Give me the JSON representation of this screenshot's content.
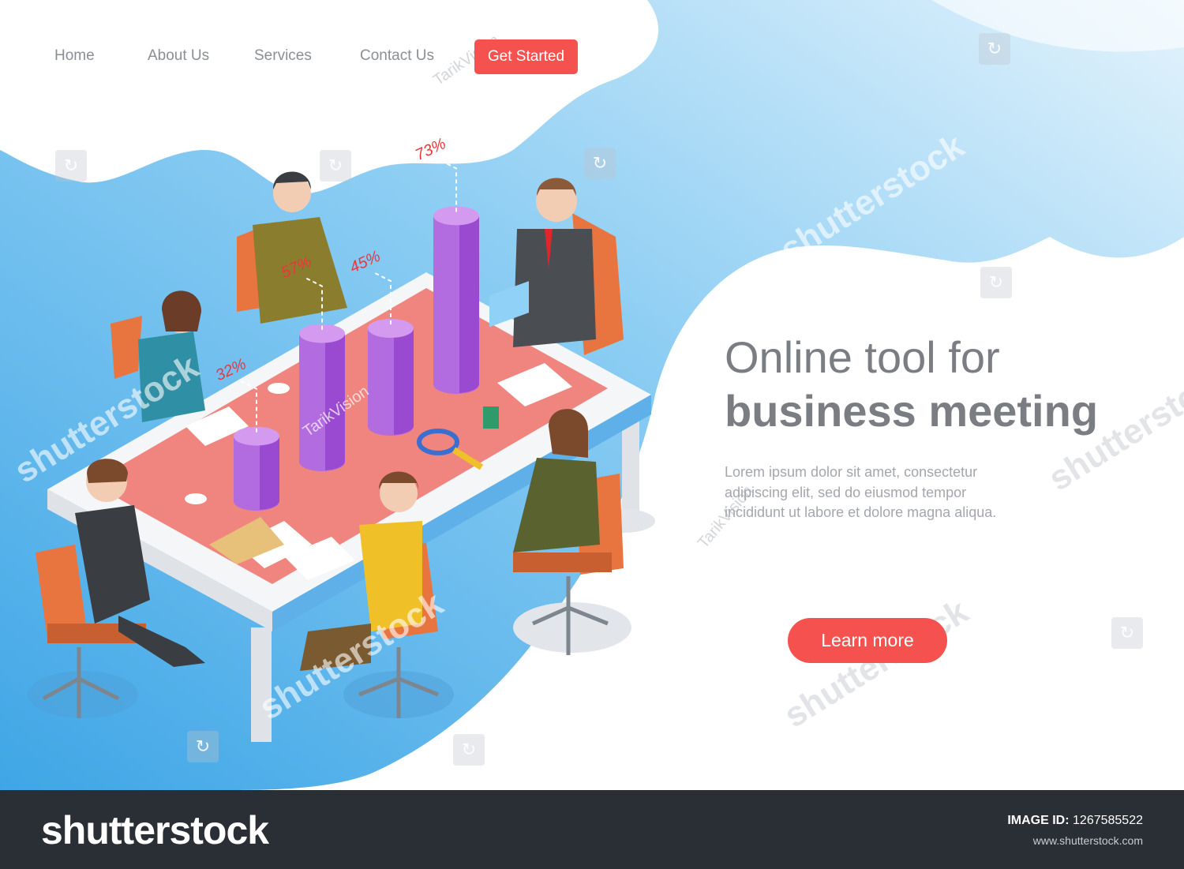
{
  "nav": {
    "items": [
      {
        "label": "Home"
      },
      {
        "label": "About Us"
      },
      {
        "label": "Services"
      },
      {
        "label": "Contact Us"
      }
    ],
    "cta_label": "Get Started"
  },
  "hero": {
    "title_line1": "Online tool for",
    "title_line2": "business meeting",
    "body": "Lorem ipsum dolor sit amet, consectetur adipiscing elit, sed do eiusmod tempor incididunt ut labore et dolore magna aliqua.",
    "button_label": "Learn more"
  },
  "illustration": {
    "bars": [
      {
        "label": "32%",
        "value": 32
      },
      {
        "label": "57%",
        "value": 57
      },
      {
        "label": "45%",
        "value": 45
      },
      {
        "label": "73%",
        "value": 73
      }
    ]
  },
  "watermark": {
    "brand": "shutterstock",
    "author": "TarikVision"
  },
  "footer": {
    "logo": "shutterstock",
    "image_id_label": "IMAGE ID:",
    "image_id": "1267585522",
    "url": "www.shutterstock.com"
  },
  "colors": {
    "accent": "#f5514f",
    "sky": "#5ab2e8",
    "table_top": "#f07e78",
    "bar": "#b36be0",
    "footer": "#2a2e35"
  }
}
